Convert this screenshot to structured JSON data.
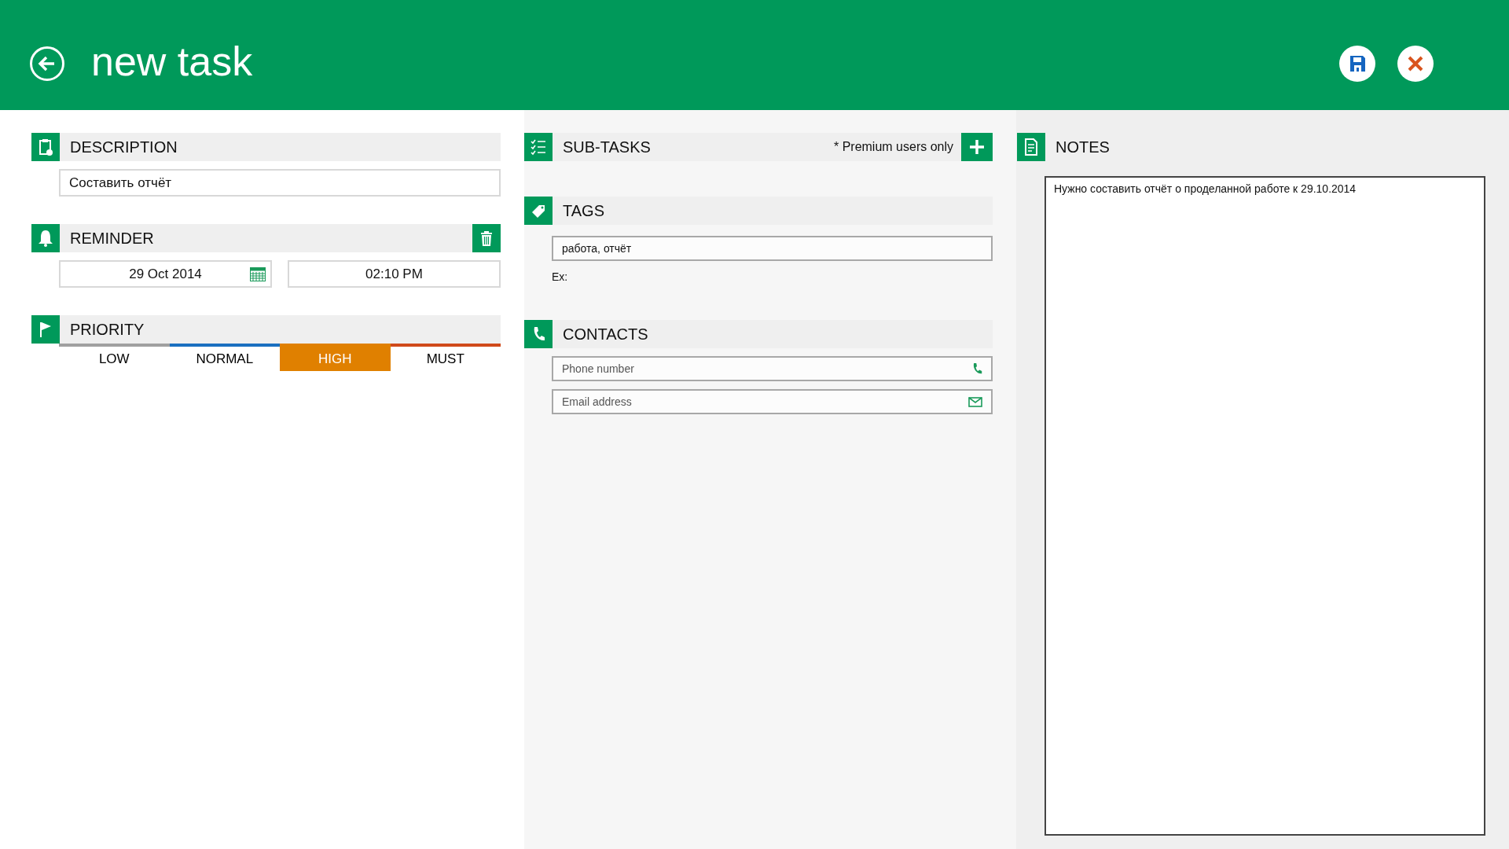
{
  "header": {
    "title": "new task"
  },
  "description": {
    "title": "DESCRIPTION",
    "value": "Составить отчёт"
  },
  "reminder": {
    "title": "REMINDER",
    "date": "29 Oct 2014",
    "time": "02:10 PM"
  },
  "priority": {
    "title": "PRIORITY",
    "options": [
      {
        "label": "LOW",
        "color": "#a0a0a0",
        "selected": false
      },
      {
        "label": "NORMAL",
        "color": "#1a6fc0",
        "selected": false
      },
      {
        "label": "HIGH",
        "color": "#e08000",
        "selected": true
      },
      {
        "label": "MUST",
        "color": "#d04a1a",
        "selected": false
      }
    ]
  },
  "subtasks": {
    "title": "SUB-TASKS",
    "note": "* Premium users only"
  },
  "tags": {
    "title": "TAGS",
    "value": "работа, отчёт",
    "example": "Ex:"
  },
  "contacts": {
    "title": "CONTACTS",
    "phone_placeholder": "Phone number",
    "email_placeholder": "Email address"
  },
  "notes": {
    "title": "NOTES",
    "value": "Нужно составить отчёт о проделанной работе к 29.10.2014"
  }
}
